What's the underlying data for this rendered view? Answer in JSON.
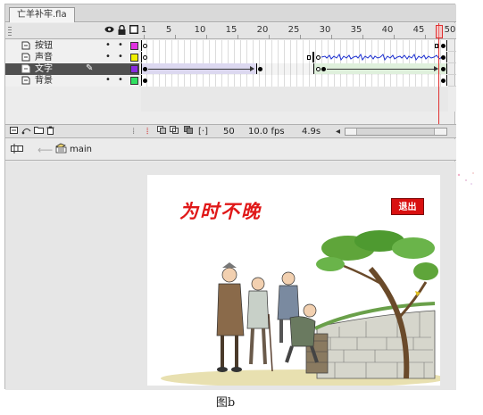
{
  "document": {
    "tab_label": "亡羊补牢.fla"
  },
  "timeline": {
    "ruler_numbers": [
      "1",
      "5",
      "10",
      "15",
      "20",
      "25",
      "30",
      "35",
      "40",
      "45",
      "50"
    ],
    "header_icons": [
      "eye-icon",
      "lock-icon",
      "outline-icon"
    ],
    "layers": [
      {
        "name": "按钮",
        "color": "#e030e0",
        "selected": false
      },
      {
        "name": "声音",
        "color": "#f0f000",
        "selected": false
      },
      {
        "name": "文字",
        "color": "#8a2be2",
        "selected": true
      },
      {
        "name": "背景",
        "color": "#30e060",
        "selected": false
      }
    ],
    "current_frame": "50",
    "frame_rate": "10.0 fps",
    "elapsed_time": "4.9s"
  },
  "editbar": {
    "scene_label": "main"
  },
  "stage": {
    "title": "为时不晚",
    "exit_button": "退出",
    "title_color": "#e01818"
  },
  "caption": "图b"
}
